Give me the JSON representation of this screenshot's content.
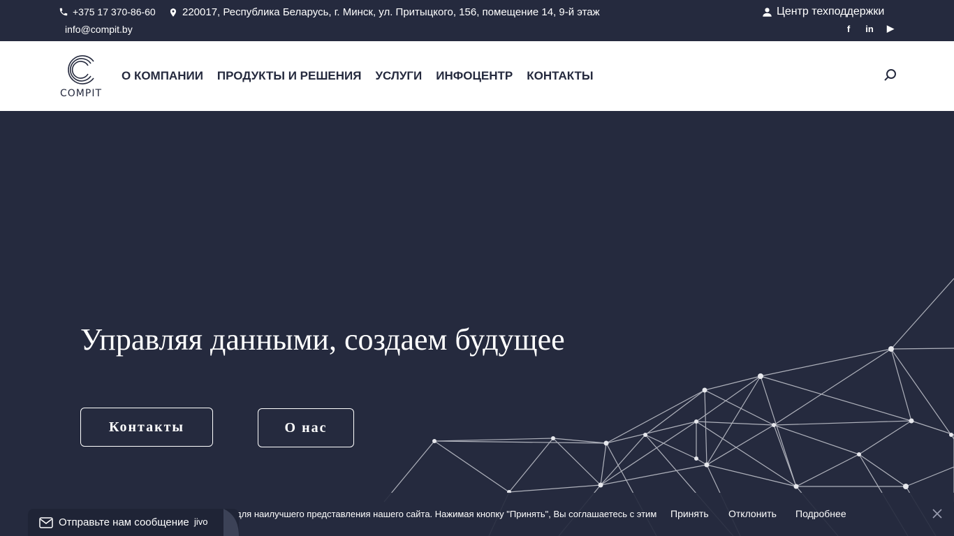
{
  "topbar": {
    "phone": "+375 17 370-86-60",
    "address": "220017, Республика Беларусь, г. Минск, ул. Притыцкого, 156, помещение 14, 9-й этаж",
    "email": "info@compit.by",
    "support_label": "Центр техподдержки",
    "socials": [
      {
        "icon": "facebook-icon",
        "label": "f"
      },
      {
        "icon": "linkedin-icon",
        "label": "in"
      },
      {
        "icon": "youtube-icon",
        "label": "▶"
      }
    ]
  },
  "header": {
    "logo_text": "COMPIT",
    "nav": [
      {
        "label": "О КОМПАНИИ"
      },
      {
        "label": "ПРОДУКТЫ И РЕШЕНИЯ"
      },
      {
        "label": "УСЛУГИ"
      },
      {
        "label": "ИНФОЦЕНТР"
      },
      {
        "label": "КОНТАКТЫ"
      }
    ]
  },
  "hero": {
    "title": "Управляя данными, создаем будущее",
    "btn_contacts": "Контакты",
    "btn_about": "О нас"
  },
  "cookie": {
    "text": "для наилучшего представления нашего сайта. Нажимая кнопку \"Принять\", Вы соглашаетесь с этим",
    "accept": "Принять",
    "decline": "Отклонить",
    "more": "Подробнее"
  },
  "jivo": {
    "label": "Отправьте нам сообщение",
    "brand": "jivo"
  },
  "colors": {
    "background": "#252a3e",
    "header_bg": "#ffffff",
    "text_dark": "#252a3e"
  }
}
